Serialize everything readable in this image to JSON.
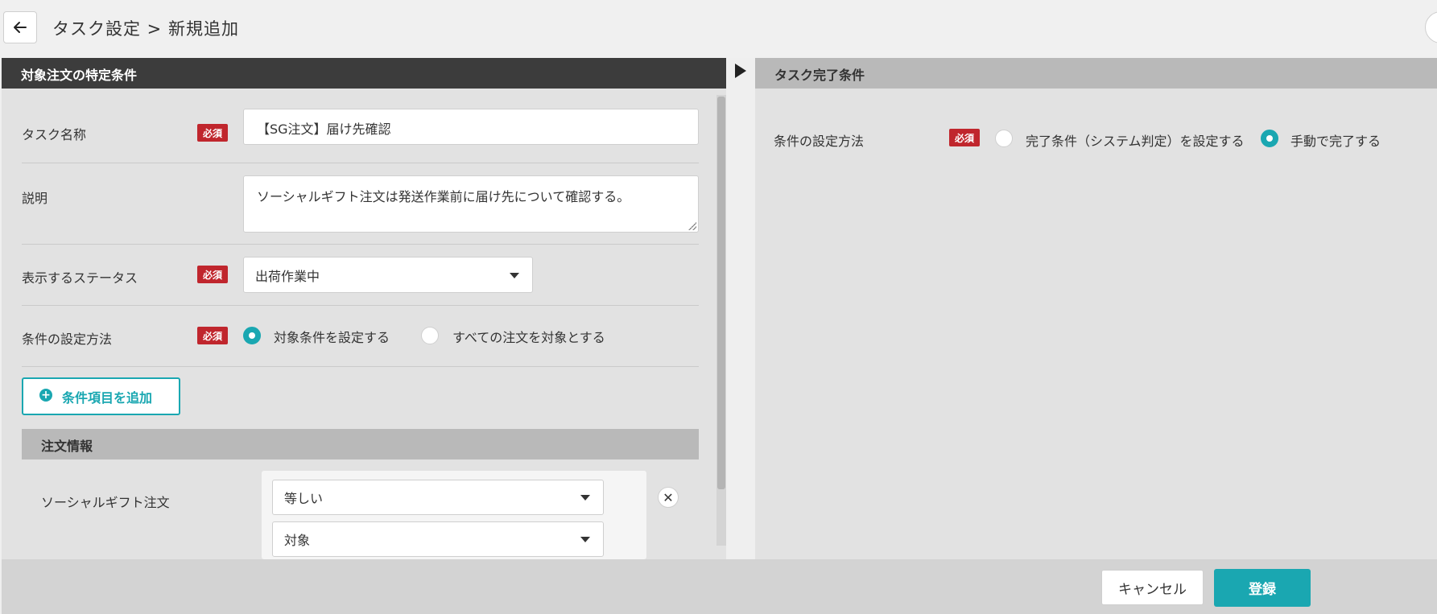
{
  "header": {
    "title": "タスク設定 > 新規追加",
    "back_icon": "arrow-left-icon"
  },
  "left_panel": {
    "title": "対象注文の特定条件",
    "required_badge": "必須",
    "task_name": {
      "label": "タスク名称",
      "value": "【SG注文】届け先確認"
    },
    "description": {
      "label": "説明",
      "value": "ソーシャルギフト注文は発送作業前に届け先について確認する。"
    },
    "status": {
      "label": "表示するステータス",
      "selected": "出荷作業中"
    },
    "condition_method": {
      "label": "条件の設定方法",
      "options": [
        {
          "label": "対象条件を設定する",
          "checked": true
        },
        {
          "label": "すべての注文を対象とする",
          "checked": false
        }
      ]
    },
    "add_condition_button": "条件項目を追加",
    "section_title": "注文情報",
    "condition": {
      "label": "ソーシャルギフト注文",
      "operator": "等しい",
      "value": "対象"
    }
  },
  "right_panel": {
    "title": "タスク完了条件",
    "required_badge": "必須",
    "method": {
      "label": "条件の設定方法",
      "options": [
        {
          "label": "完了条件（システム判定）を設定する",
          "checked": false
        },
        {
          "label": "手動で完了する",
          "checked": true
        }
      ]
    }
  },
  "footer": {
    "cancel_label": "キャンセル",
    "submit_label": "登録"
  },
  "colors": {
    "accent": "#1aa7b1",
    "required": "#c0262d",
    "dark_header": "#3c3c3c"
  }
}
